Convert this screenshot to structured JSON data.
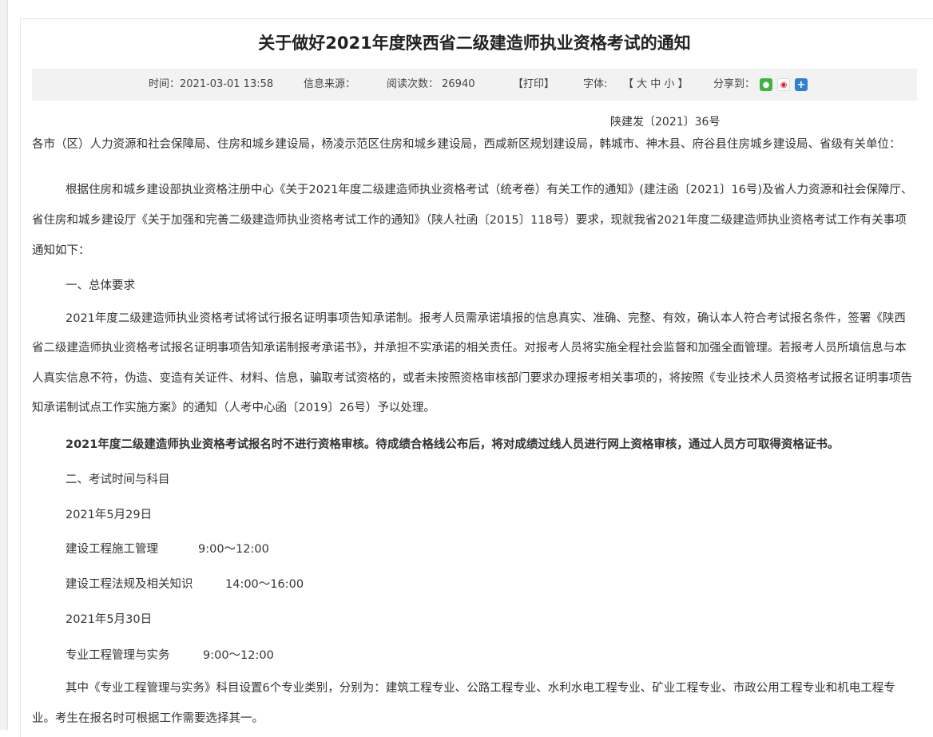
{
  "article": {
    "title": "关于做好2021年度陕西省二级建造师执业资格考试的通知",
    "meta": {
      "time": "时间：2021-03-01 13:58",
      "source": "信息来源：",
      "reads": "阅读次数： 26940",
      "print": "【打印】",
      "font_label": "字体:",
      "font_sizes": "【 大  中  小 】",
      "share_label": "分享到：",
      "share_icons": [
        "wechat-icon",
        "weibo-icon",
        "more-share-icon"
      ]
    },
    "doc_number": "陕建发〔2021〕36号",
    "addressee": "各市（区）人力资源和社会保障局、住房和城乡建设局，杨凌示范区住房和城乡建设局，西咸新区规划建设局，韩城市、神木县、府谷县住房城乡建设局、省级有关单位：",
    "intro": "根据住房和城乡建设部执业资格注册中心《关于2021年度二级建造师执业资格考试（统考卷）有关工作的通知》(建注函〔2021〕16号)及省人力资源和社会保障厅、省住房和城乡建设厅《关于加强和完善二级建造师执业资格考试工作的通知》（陕人社函〔2015〕118号）要求，现就我省2021年度二级建造师执业资格考试工作有关事项通知如下：",
    "section1_heading": "一、总体要求",
    "section1_para": "2021年度二级建造师执业资格考试将试行报名证明事项告知承诺制。报考人员需承诺填报的信息真实、准确、完整、有效，确认本人符合考试报名条件，签署《陕西省二级建造师执业资格考试报名证明事项告知承诺制报考承诺书》，并承担不实承诺的相关责任。对报考人员将实施全程社会监督和加强全面管理。若报考人员所填信息与本人真实信息不符，伪造、变造有关证件、材料、信息，骗取考试资格的，或者未按照资格审核部门要求办理报考相关事项的，将按照《专业技术人员资格考试报名证明事项告知承诺制试点工作实施方案》的通知（人考中心函〔2019〕26号）予以处理。",
    "section1_bold": "2021年度二级建造师执业资格考试报名时不进行资格审核。待成绩合格线公布后，将对成绩过线人员进行网上资格审核，通过人员方可取得资格证书。",
    "section2_heading": "二、考试时间与科目",
    "schedule": [
      {
        "date": "2021年5月29日"
      },
      {
        "subject": "建设工程施工管理",
        "time": "9:00～12:00"
      },
      {
        "subject": "建设工程法规及相关知识",
        "time": "14:00～16:00"
      },
      {
        "date": "2021年5月30日"
      },
      {
        "subject": "专业工程管理与实务",
        "time": "9:00～12:00"
      }
    ],
    "section2_para": "其中《专业工程管理与实务》科目设置6个专业类别，分别为：建筑工程专业、公路工程专业、水利水电工程专业、矿业工程专业、市政公用工程专业和机电工程专业。考生在报名时可根据工作需要选择其一。"
  },
  "colors": {
    "meta_bar_bg": "#f2f2f2",
    "wechat": "#3fb33f",
    "weibo": "#e6162d",
    "share_plus": "#2f80d1"
  }
}
